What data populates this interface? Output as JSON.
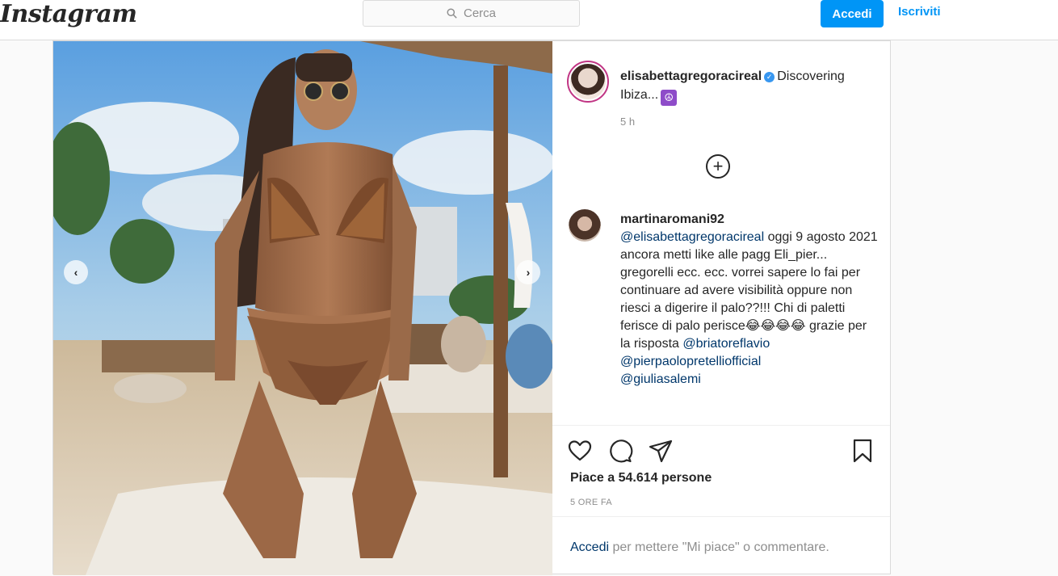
{
  "header": {
    "logo": "Instagram",
    "search_placeholder": "Cerca",
    "login_label": "Accedi",
    "signup_label": "Iscriviti"
  },
  "post": {
    "author": "elisabettagregoracireal",
    "caption": "Discovering Ibiza...",
    "caption_emoji": "☮",
    "time_ago": "5 h",
    "comment": {
      "username": "martinaromani92",
      "mention_author": "@elisabettagregoracireal",
      "text_1": " oggi 9 agosto 2021 ancora metti like alle pagg Eli_pier... gregorelli ecc. ecc. vorrei sapere lo fai per continuare ad avere visibilità oppure non riesci a digerire il palo??!!! Chi di paletti ferisce di palo perisce",
      "emojis": "😂😂😂😂",
      "text_2": " grazie per la risposta ",
      "mention_1": "@briatoreflavio",
      "mention_2": "@pierpaolopretelliofficial",
      "mention_3": "@giuliasalemi"
    },
    "likes_text": "Piace a 54.614 persone",
    "timestamp": "5 ORE FA",
    "login_link": "Accedi",
    "login_prompt": " per mettere \"Mi piace\" o commentare."
  },
  "colors": {
    "accent": "#0095f6",
    "border": "#dbdbdb",
    "muted": "#8e8e8e",
    "mention": "#00376b"
  },
  "icons": [
    "search-icon",
    "verified-icon",
    "plus-circle-icon",
    "heart-icon",
    "comment-icon",
    "share-icon",
    "bookmark-icon",
    "chevron-left-icon",
    "chevron-right-icon"
  ]
}
